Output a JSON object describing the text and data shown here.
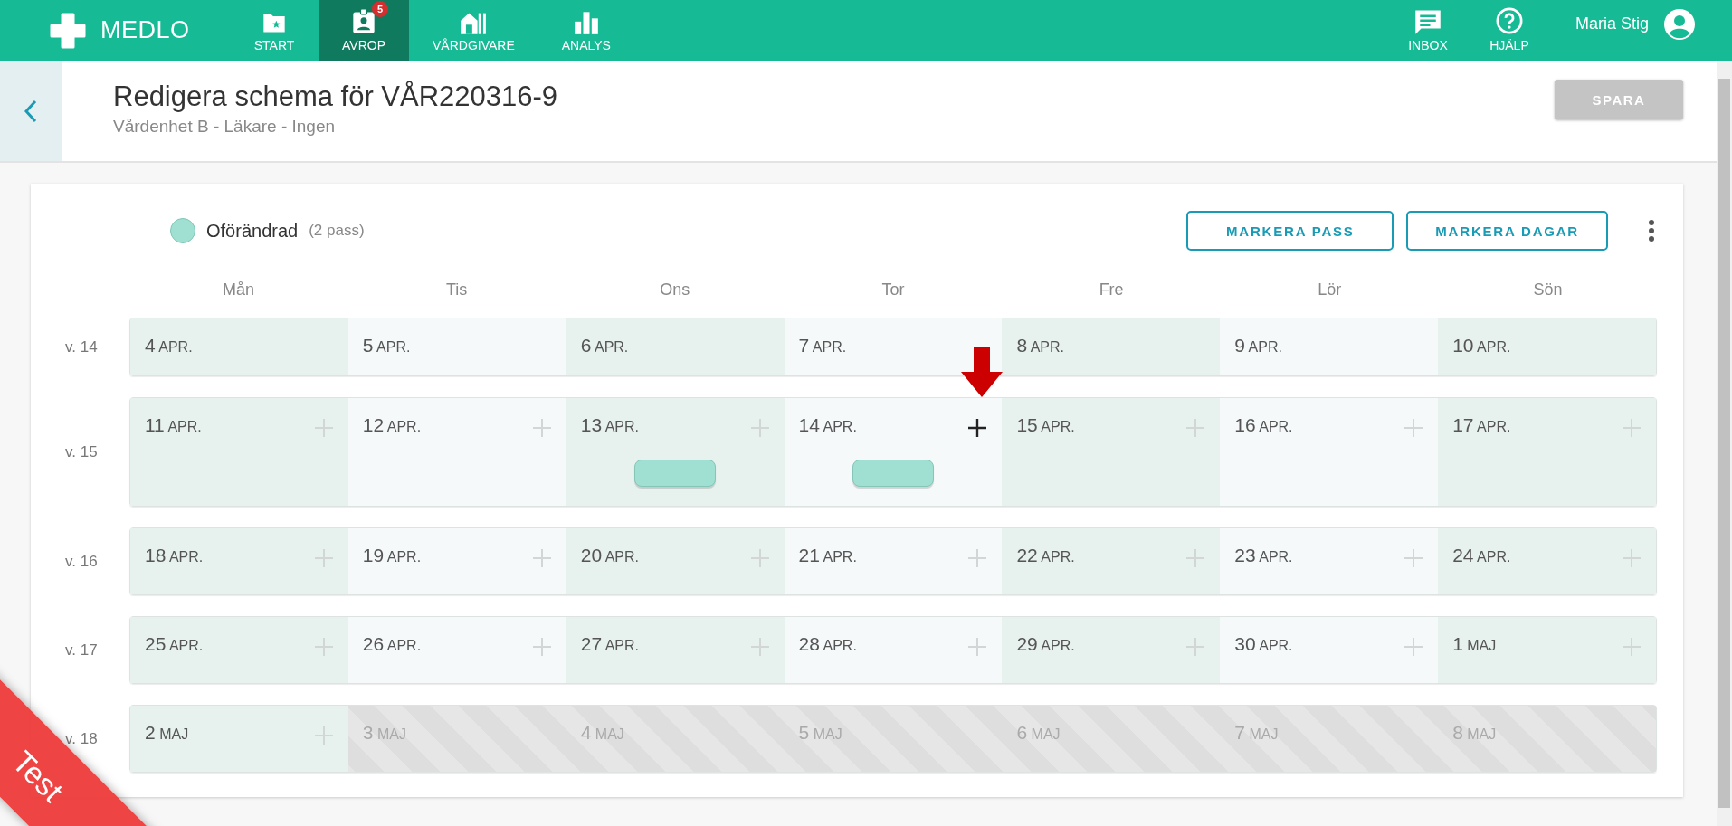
{
  "nav": {
    "brand": "MEDLO",
    "items": [
      {
        "label": "START",
        "selected": false
      },
      {
        "label": "AVROP",
        "selected": true,
        "count": "5"
      },
      {
        "label": "VÅRDGIVARE",
        "selected": false
      },
      {
        "label": "ANALYS",
        "selected": false
      }
    ],
    "right": [
      {
        "label": "INBOX"
      },
      {
        "label": "HJÄLP"
      }
    ],
    "user": "Maria Stig"
  },
  "header": {
    "title": "Redigera schema för VÅR220316-9",
    "subtitle": "Vårdenhet B - Läkare - Ingen",
    "save": {
      "label": "SPARA",
      "disabled": true
    }
  },
  "legend": {
    "color": "#a0e0d2",
    "label": "Oförändrad",
    "count": "(2 pass)"
  },
  "actions": [
    "MARKERA PASS",
    "MARKERA DAGAR"
  ],
  "weekdays": [
    "Mån",
    "Tis",
    "Ons",
    "Tor",
    "Fre",
    "Lör",
    "Sön"
  ],
  "weeks": [
    {
      "label": "v. 14",
      "days": [
        {
          "day": "4",
          "month": "APR.",
          "kind": "plain"
        },
        {
          "day": "5",
          "month": "APR.",
          "kind": "plain"
        },
        {
          "day": "6",
          "month": "APR.",
          "kind": "plain"
        },
        {
          "day": "7",
          "month": "APR.",
          "kind": "plain"
        },
        {
          "day": "8",
          "month": "APR.",
          "kind": "plain"
        },
        {
          "day": "9",
          "month": "APR.",
          "kind": "plain"
        },
        {
          "day": "10",
          "month": "APR.",
          "kind": "plain"
        }
      ]
    },
    {
      "label": "v. 15",
      "days": [
        {
          "day": "11",
          "month": "APR.",
          "kind": "add",
          "highlighted": false,
          "shift": false
        },
        {
          "day": "12",
          "month": "APR.",
          "kind": "add",
          "highlighted": false,
          "shift": false
        },
        {
          "day": "13",
          "month": "APR.",
          "kind": "add",
          "highlighted": false,
          "shift": true
        },
        {
          "day": "14",
          "month": "APR.",
          "kind": "add",
          "highlighted": true,
          "shift": true
        },
        {
          "day": "15",
          "month": "APR.",
          "kind": "add",
          "highlighted": false,
          "shift": false
        },
        {
          "day": "16",
          "month": "APR.",
          "kind": "add",
          "highlighted": false,
          "shift": false
        },
        {
          "day": "17",
          "month": "APR.",
          "kind": "add",
          "highlighted": false,
          "shift": false
        }
      ]
    },
    {
      "label": "v. 16",
      "days": [
        {
          "day": "18",
          "month": "APR.",
          "kind": "add",
          "highlighted": false,
          "shift": false
        },
        {
          "day": "19",
          "month": "APR.",
          "kind": "add",
          "highlighted": false,
          "shift": false
        },
        {
          "day": "20",
          "month": "APR.",
          "kind": "add",
          "highlighted": false,
          "shift": false
        },
        {
          "day": "21",
          "month": "APR.",
          "kind": "add",
          "highlighted": false,
          "shift": false
        },
        {
          "day": "22",
          "month": "APR.",
          "kind": "add",
          "highlighted": false,
          "shift": false
        },
        {
          "day": "23",
          "month": "APR.",
          "kind": "add",
          "highlighted": false,
          "shift": false
        },
        {
          "day": "24",
          "month": "APR.",
          "kind": "add",
          "highlighted": false,
          "shift": false
        }
      ]
    },
    {
      "label": "v. 17",
      "days": [
        {
          "day": "25",
          "month": "APR.",
          "kind": "add",
          "highlighted": false,
          "shift": false
        },
        {
          "day": "26",
          "month": "APR.",
          "kind": "add",
          "highlighted": false,
          "shift": false
        },
        {
          "day": "27",
          "month": "APR.",
          "kind": "add",
          "highlighted": false,
          "shift": false
        },
        {
          "day": "28",
          "month": "APR.",
          "kind": "add",
          "highlighted": false,
          "shift": false
        },
        {
          "day": "29",
          "month": "APR.",
          "kind": "add",
          "highlighted": false,
          "shift": false
        },
        {
          "day": "30",
          "month": "APR.",
          "kind": "add",
          "highlighted": false,
          "shift": false
        },
        {
          "day": "1",
          "month": "MAJ",
          "kind": "add",
          "highlighted": false,
          "shift": false
        }
      ]
    },
    {
      "label": "v. 18",
      "days": [
        {
          "day": "2",
          "month": "MAJ",
          "kind": "add",
          "highlighted": false,
          "shift": false
        },
        {
          "day": "3",
          "month": "MAJ",
          "kind": "disabled"
        },
        {
          "day": "4",
          "month": "MAJ",
          "kind": "disabled"
        },
        {
          "day": "5",
          "month": "MAJ",
          "kind": "disabled"
        },
        {
          "day": "6",
          "month": "MAJ",
          "kind": "disabled"
        },
        {
          "day": "7",
          "month": "MAJ",
          "kind": "disabled"
        },
        {
          "day": "8",
          "month": "MAJ",
          "kind": "disabled"
        }
      ]
    }
  ],
  "ribbon": "Test"
}
